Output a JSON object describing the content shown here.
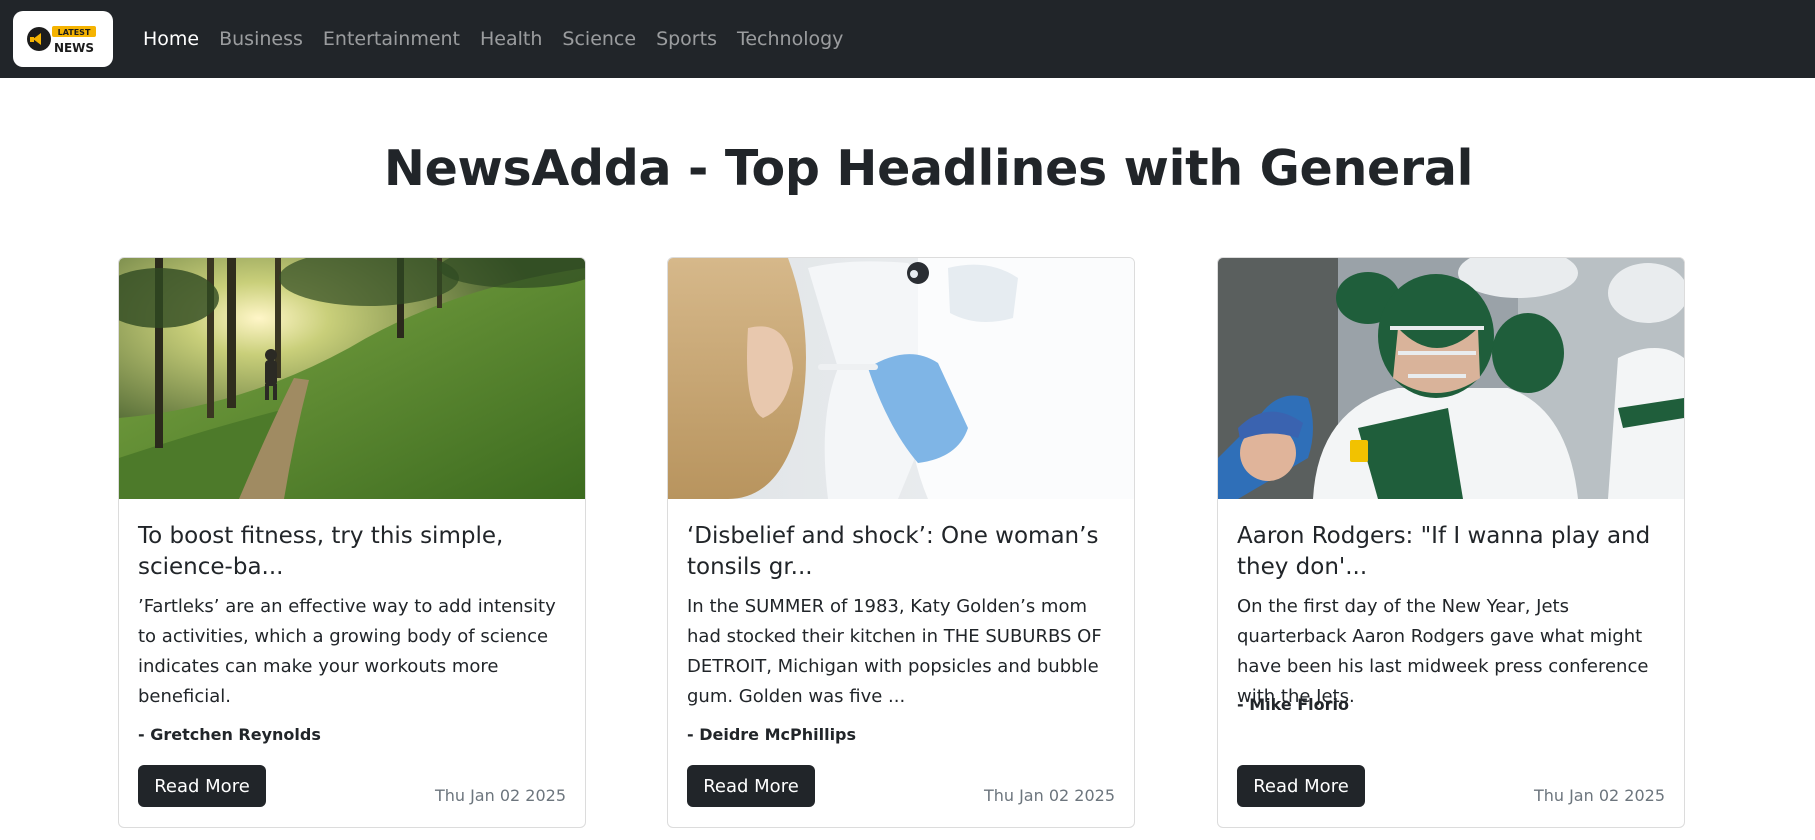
{
  "brand": {
    "logo_line1": "LATEST",
    "logo_line2": "NEWS"
  },
  "nav": {
    "items": [
      {
        "label": "Home",
        "active": true
      },
      {
        "label": "Business"
      },
      {
        "label": "Entertainment"
      },
      {
        "label": "Health"
      },
      {
        "label": "Science"
      },
      {
        "label": "Sports"
      },
      {
        "label": "Technology"
      }
    ]
  },
  "page": {
    "title": "NewsAdda - Top Headlines with General"
  },
  "articles": [
    {
      "image_icon": "forest-trail-runner-image",
      "title": "To boost fitness, try this simple, science-ba...",
      "description": "’Fartleks’ are an effective way to add intensity to activities, which a growing body of science indicates can make your workouts more beneficial.",
      "author": "- Gretchen Reynolds",
      "button_label": "Read More",
      "date": "Thu Jan 02 2025"
    },
    {
      "image_icon": "doctor-throat-exam-image",
      "title": "‘Disbelief and shock’: One woman’s tonsils gr...",
      "description": "In the SUMMER of 1983, Katy Golden’s mom had stocked their kitchen in THE SUBURBS OF DETROIT, Michigan with popsicles and bubble gum. Golden was five ...",
      "author": "- Deidre McPhillips",
      "button_label": "Read More",
      "date": "Thu Jan 02 2025"
    },
    {
      "image_icon": "football-player-helmet-image",
      "title": "Aaron Rodgers: \"If I wanna play and they don'...",
      "description": "On the first day of the New Year, Jets quarterback Aaron Rodgers gave what might have been his last midweek press conference with the Jets.",
      "author": "- Mike Florio",
      "button_label": "Read More",
      "date": "Thu Jan 02 2025"
    }
  ],
  "colors": {
    "navbar_bg": "#212529",
    "button_bg": "#212529",
    "logo_accent": "#f5b301"
  }
}
